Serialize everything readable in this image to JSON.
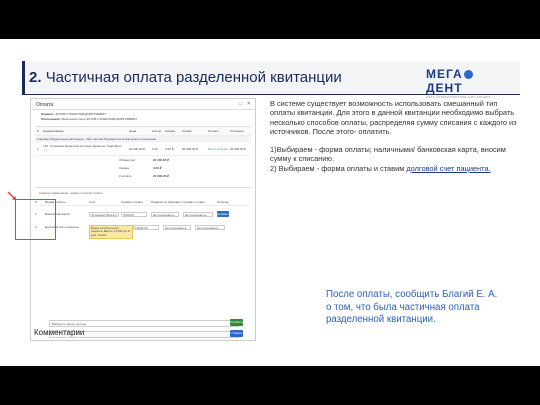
{
  "slide": {
    "number": "2.",
    "title": "Частичная оплата разделенной квитанции",
    "logo_text_left": "МЕГА",
    "logo_text_right": "ДЕНТ",
    "logo_subtitle": "СЕТЬ СТОМАТОЛОГИЧЕСКИХ КЛИНИК",
    "description": "В системе существует возможность использовать смешанный тип оплаты квитанции. Для этого в данной квитанции необходимо выбрать несколько способов оплаты, распределяя сумму списания с каждого из источников. После этого- оплатить.",
    "step1": "1)Выбираем - форма оплаты; наличными/ банковская карта, вносим сумму к списанию.",
    "step2_prefix": "2) Выбираем - форма оплаты и ставим ",
    "step2_link": "долговой счет пациента.",
    "note": "После оплаты, сообщить Благий Е. А. о том, что была частичная оплата разделенной квитанции.",
    "colors": {
      "title": "#1b2a58",
      "note": "#2b5fb8",
      "highlight": "#e43b3b"
    }
  },
  "screenshot": {
    "title": "Оплата",
    "patient_label": "Пациент:",
    "patient_value": "ЗОТОВ СТАНИСЛАВ ДМИТРИЕВИЧ",
    "payer_label": "Плательщик:",
    "payer_value": "Физическое лицо ЗОТОВ СТАНИСЛАВ ДМИТРИЕВИЧ",
    "table_headers": [
      "#",
      "Наименование",
      "Цена",
      "Кол-во",
      "Скидка",
      "Сумма",
      "Оплата",
      "Оплачено"
    ],
    "section": "Клиника: Разделенная квитанция - Обе галочки Приемистое клинического отделения",
    "row": [
      "1",
      "I 30. Установка брекетной системы (брекеты, Тема Брос, ...)",
      "20 000.00 ₽",
      "1.00",
      "0.00 ₽",
      "20 000.00 ₽",
      "Итого к оплате",
      "20 000.00 ₽"
    ],
    "totals": [
      {
        "label": "Общая сум.",
        "value": "20 000.00 ₽"
      },
      {
        "label": "Скидка",
        "value": "0.00 ₽"
      },
      {
        "label": "К оплате",
        "value": "20 000.00 ₽"
      }
    ],
    "payment_prompt": "Укажите примечание, сумму и способ оплаты",
    "payment_headers": [
      "#",
      "Форма оплаты",
      "Счет",
      "Сумма к оплате",
      "Подарок на сберкарту",
      "Сумма к оплате",
      "Остаток"
    ],
    "payment_rows": [
      {
        "n": "1",
        "method": "Банковская карта",
        "account": "Основной (Бухгалт...)",
        "amount": "7000.00",
        "gift": "Не предъявлен",
        "rest": "Не предъявлен"
      },
      {
        "n": "2",
        "method": "Долговой счет пациента",
        "account": "ОСНОВНОЙ",
        "amount": "13000.00",
        "gift": "Не предъявлен",
        "rest": "Не предъявлен"
      }
    ],
    "hint": "Можно оплатить в долг пациента. Вместе: 13 000 руб. В долг. Оплата",
    "add_button": "Добавить",
    "select_placeholder": "Выберите метод оплаты",
    "comments_label": "Комментарии",
    "pay_button": "Оплатить",
    "cancel_button": "Отмена"
  }
}
